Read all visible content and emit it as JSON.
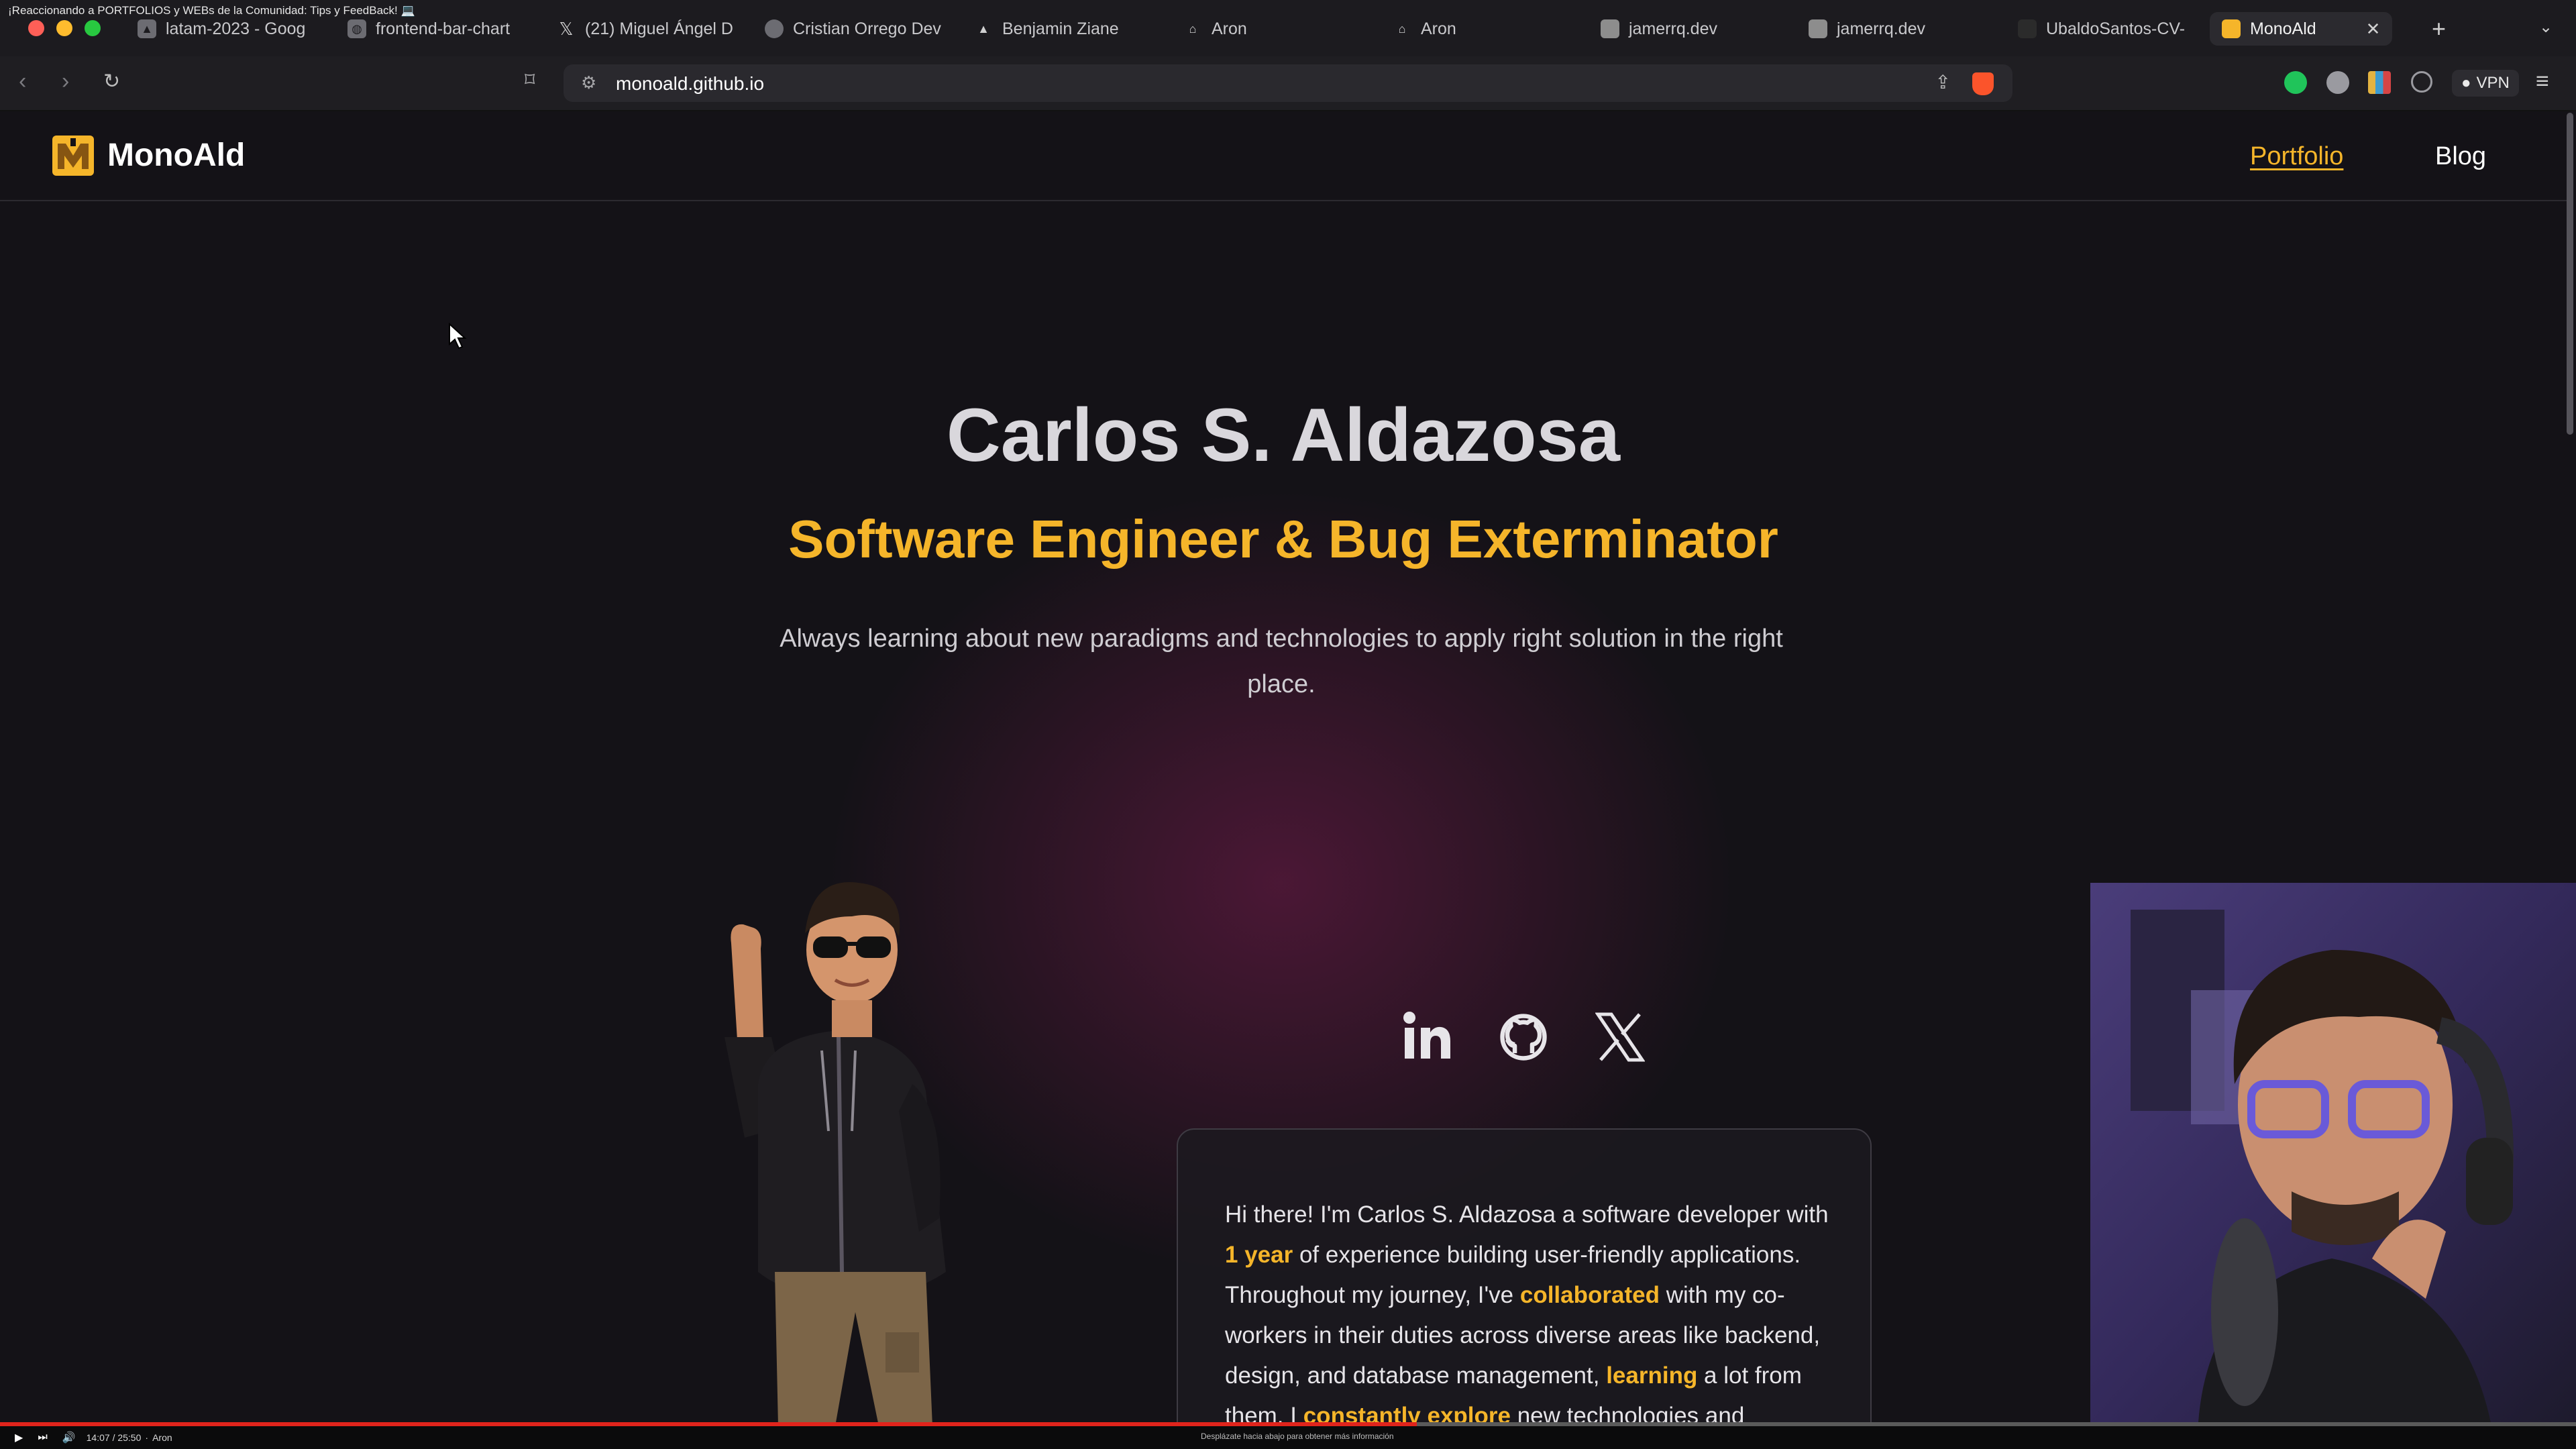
{
  "video": {
    "title": "¡Reaccionando a PORTFOLIOS y WEBs de la Comunidad: Tips y FeedBack! 💻",
    "time": "14:07 / 25:50",
    "chapter": "Aron",
    "caption": "Desplázate hacia abajo para obtener más información",
    "progress": 0.55
  },
  "browser": {
    "tabs": [
      {
        "label": "latam-2023 - Goog",
        "icon": "drive-icon"
      },
      {
        "label": "frontend-bar-chart",
        "icon": "globe-icon"
      },
      {
        "label": "(21) Miguel Ángel D",
        "icon": "x-logo-icon"
      },
      {
        "label": "Cristian Orrego Dev",
        "icon": "avatar-icon"
      },
      {
        "label": "Benjamin Ziane",
        "icon": "triangle-icon"
      },
      {
        "label": "Aron",
        "icon": "rocket-icon"
      },
      {
        "label": "Aron",
        "icon": "rocket-icon"
      },
      {
        "label": "jamerrq.dev",
        "icon": "site-icon"
      },
      {
        "label": "jamerrq.dev",
        "icon": "site-icon"
      },
      {
        "label": "UbaldoSantos-CV-",
        "icon": "document-icon"
      },
      {
        "label": "MonoAld",
        "icon": "monoald-icon"
      }
    ],
    "active_tab": "MonoAld",
    "new_tab": "+",
    "url": "monoald.github.io",
    "vpn_label": "VPN"
  },
  "site": {
    "brand": "MonoAld",
    "nav": {
      "portfolio": "Portfolio",
      "blog": "Blog"
    },
    "name": "Carlos S. Aldazosa",
    "role": "Software Engineer & Bug Exterminator",
    "tagline": "Always learning about new paradigms and technologies to apply right solution in the right place.",
    "socials": [
      "linkedin-icon",
      "github-icon",
      "x-logo-icon"
    ],
    "about": {
      "p1": "Hi there! I'm Carlos S. Aldazosa a software developer with ",
      "h1": "1 year",
      "p2": " of experience building user-friendly applications. Throughout my journey, I've ",
      "h2": "collaborated",
      "p3": " with my co-workers in their duties across diverse areas like backend, design, and database management, ",
      "h3": "learning",
      "p4": " a lot from them. I ",
      "h4": "constantly explore",
      "p5": " new technologies and resources to build smooth and scalable apps."
    }
  },
  "colors": {
    "accent": "#f5b52a",
    "background": "#141217",
    "glow": "#781c4e"
  }
}
